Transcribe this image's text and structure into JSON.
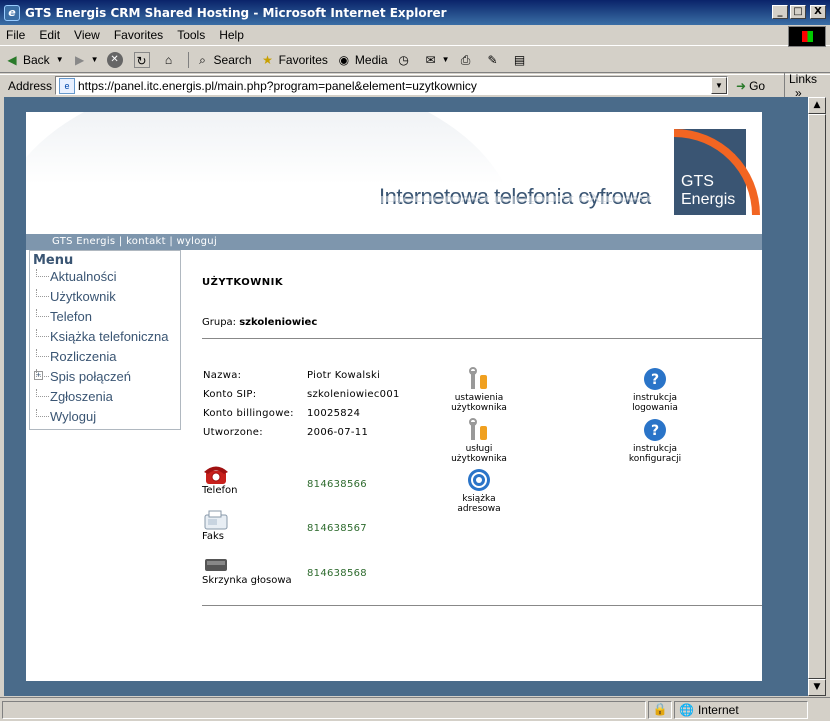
{
  "window": {
    "title": "GTS Energis CRM Shared Hosting - Microsoft Internet Explorer",
    "btn_min": "_",
    "btn_max": "□",
    "btn_close": "X"
  },
  "menubar": {
    "file": "File",
    "edit": "Edit",
    "view": "View",
    "favorites": "Favorites",
    "tools": "Tools",
    "help": "Help"
  },
  "toolbar": {
    "back": "Back",
    "search": "Search",
    "favorites": "Favorites",
    "media": "Media"
  },
  "address": {
    "label": "Address",
    "url": "https://panel.itc.energis.pl/main.php?program=panel&element=uzytkownicy",
    "go": "Go",
    "links": "Links"
  },
  "banner": {
    "tagline": "Internetowa telefonia cyfrowa",
    "logo_line1": "GTS",
    "logo_line2": "Energis"
  },
  "nav": {
    "item1": "GTS Energis",
    "sep": "|",
    "item2": "kontakt",
    "item3": "wyloguj"
  },
  "menu": {
    "header": "Menu",
    "items": [
      "Aktualności",
      "Użytkownik",
      "Telefon",
      "Książka telefoniczna",
      "Rozliczenia",
      "Spis połączeń",
      "Zgłoszenia",
      "Wyloguj"
    ]
  },
  "content": {
    "heading": "UŻYTKOWNIK",
    "group_label": "Grupa:",
    "group_value": "szkoleniowiec",
    "fields": [
      {
        "label": "Nazwa:",
        "value": "Piotr Kowalski"
      },
      {
        "label": "Konto SIP:",
        "value": "szkoleniowiec001"
      },
      {
        "label": "Konto billingowe:",
        "value": "10025824"
      },
      {
        "label": "Utworzone:",
        "value": "2006-07-11"
      }
    ],
    "devices": [
      {
        "label": "Telefon",
        "number": "814638566"
      },
      {
        "label": "Faks",
        "number": "814638567"
      },
      {
        "label": "Skrzynka głosowa",
        "number": "814638568"
      }
    ],
    "actions": {
      "settings_l1": "ustawienia",
      "settings_l2": "użytkownika",
      "services_l1": "usługi",
      "services_l2": "użytkownika",
      "addressbook_l1": "książka",
      "addressbook_l2": "adresowa",
      "login_help_l1": "instrukcja",
      "login_help_l2": "logowania",
      "config_help_l1": "instrukcja",
      "config_help_l2": "konfiguracji"
    }
  },
  "status": {
    "zone": "Internet"
  },
  "colors": {
    "brand_blue": "#3a5573",
    "brand_orange": "#f26522",
    "nav_bg": "#7e96ad",
    "number_green": "#2e6b2e"
  }
}
